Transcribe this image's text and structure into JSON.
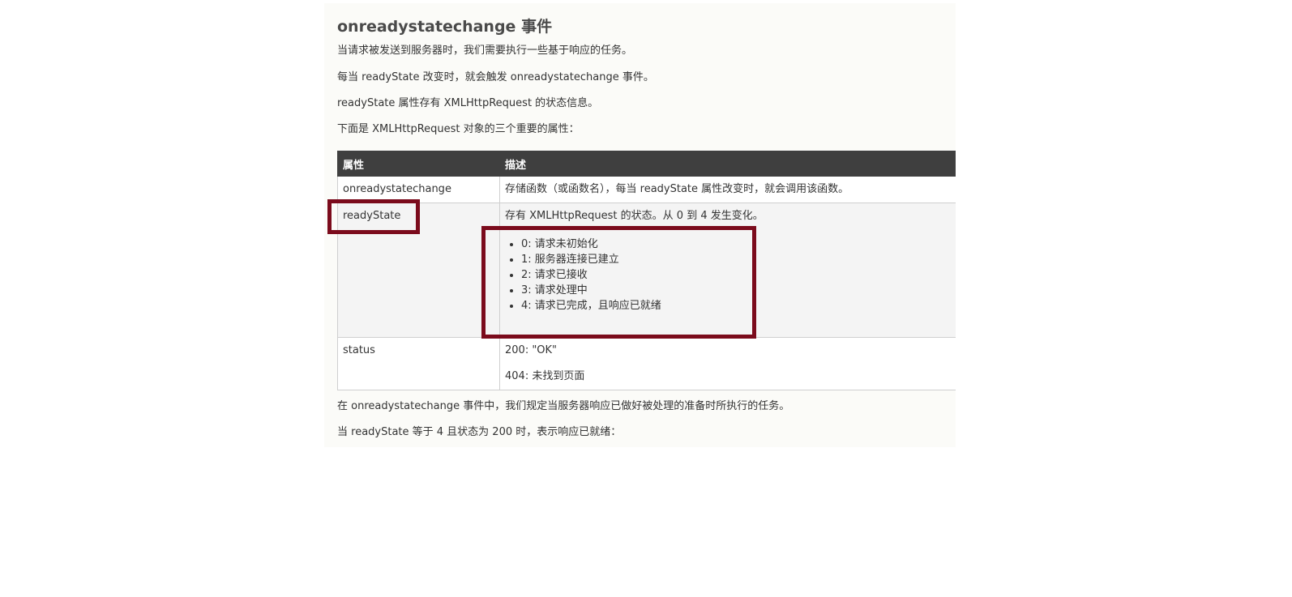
{
  "heading": "onreadystatechange 事件",
  "paragraphs": {
    "p1": "当请求被发送到服务器时，我们需要执行一些基于响应的任务。",
    "p2": "每当 readyState 改变时，就会触发 onreadystatechange 事件。",
    "p3": "readyState 属性存有 XMLHttpRequest 的状态信息。",
    "p4": "下面是 XMLHttpRequest 对象的三个重要的属性：",
    "p5": "在 onreadystatechange 事件中，我们规定当服务器响应已做好被处理的准备时所执行的任务。",
    "p6": "当 readyState 等于 4 且状态为 200 时，表示响应已就绪："
  },
  "table": {
    "headers": [
      "属性",
      "描述"
    ],
    "rows": [
      {
        "name": "onreadystatechange",
        "desc": "存储函数（或函数名），每当 readyState 属性改变时，就会调用该函数。"
      },
      {
        "name": "readyState",
        "desc": "存有 XMLHttpRequest 的状态。从 0 到 4 发生变化。",
        "states": [
          "0: 请求未初始化",
          "1: 服务器连接已建立",
          "2: 请求已接收",
          "3: 请求处理中",
          "4: 请求已完成，且响应已就绪"
        ]
      },
      {
        "name": "status",
        "desc_lines": [
          "200: \"OK\"",
          "404: 未找到页面"
        ]
      }
    ]
  },
  "colors": {
    "highlight": "#7b0b1c",
    "header_bg": "#3f3f3f",
    "panel_bg": "#fbfbf8"
  }
}
